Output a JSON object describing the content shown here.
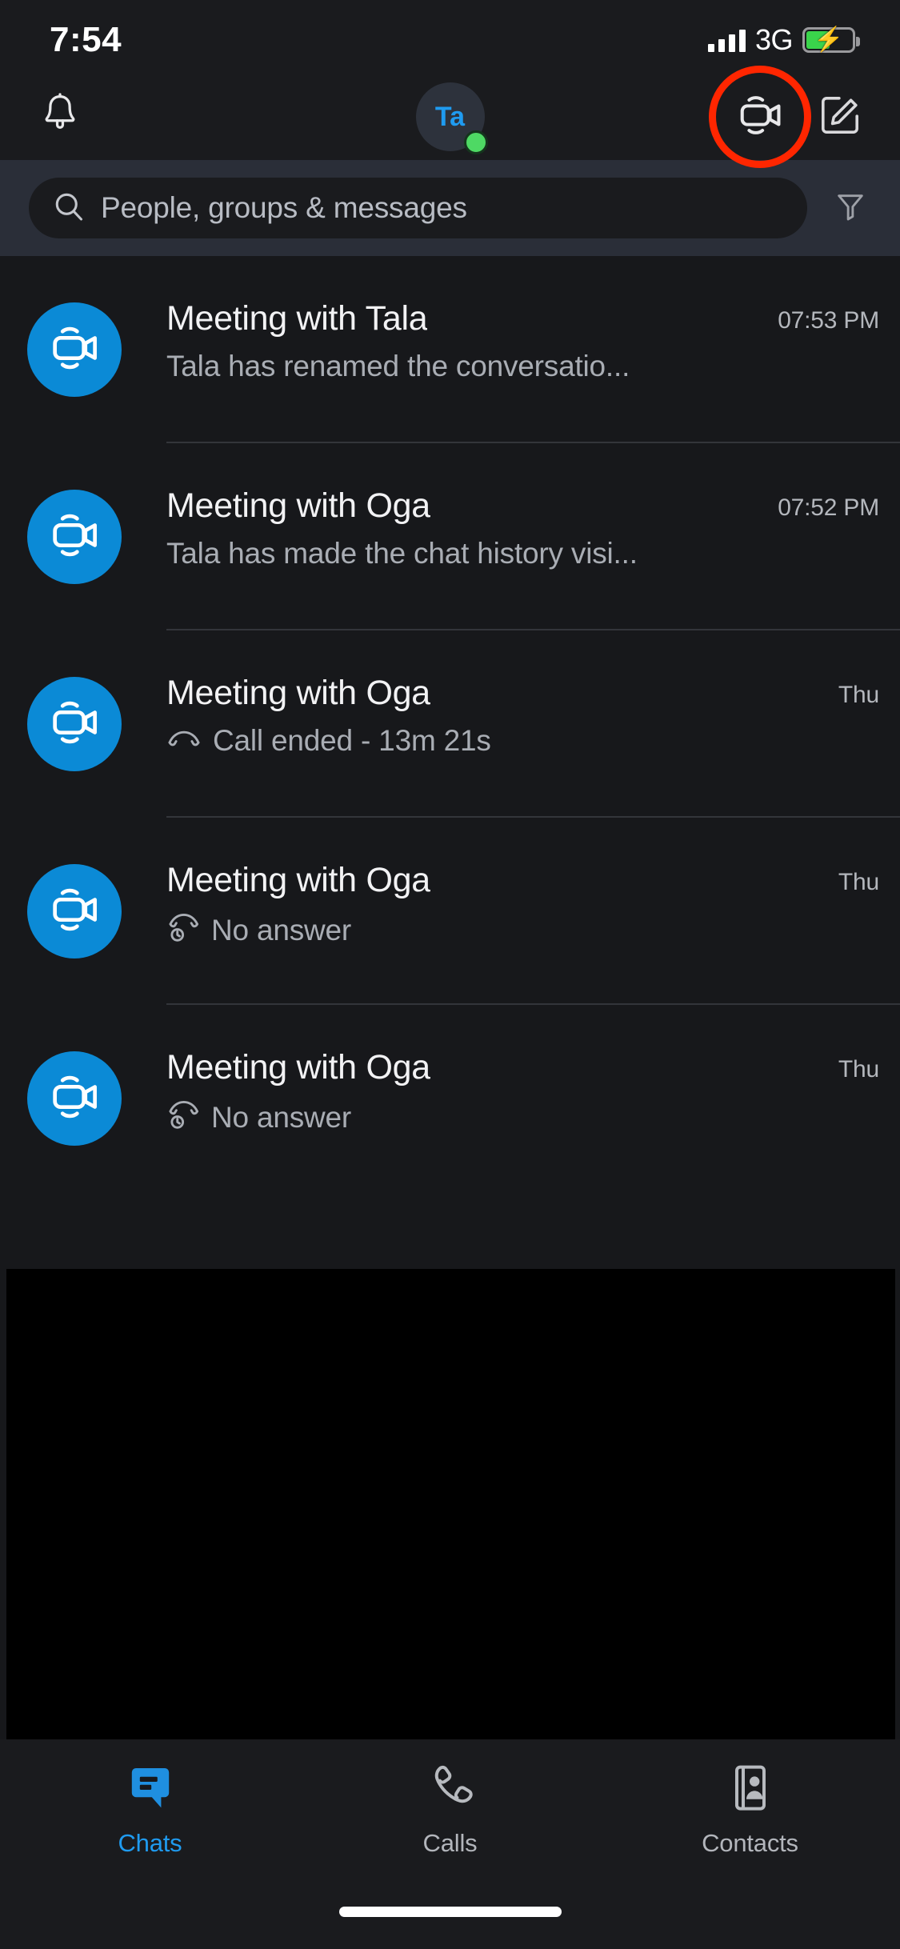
{
  "status_bar": {
    "time": "7:54",
    "carrier": "3G",
    "signal_icon": "signal-bars-icon",
    "battery_icon": "battery-charging-icon",
    "battery_level_percent": 52
  },
  "nav_bar": {
    "notifications_icon": "bell-icon",
    "avatar": {
      "initials": "Ta",
      "presence": "available",
      "presence_color": "#4ed964",
      "text_color": "#1f9bf0"
    },
    "video_call_icon": "video-camera-icon",
    "video_call_highlighted": true,
    "highlight_color": "#ff2600",
    "compose_icon": "compose-pencil-icon"
  },
  "search": {
    "placeholder": "People, groups & messages",
    "value": "",
    "search_icon": "search-icon",
    "filter_icon": "filter-funnel-icon"
  },
  "chat_list": {
    "avatar_color": "#0b8ad6",
    "items": [
      {
        "avatar_icon": "video-camera-icon",
        "title": "Meeting with Tala",
        "subtitle": "Tala has renamed the conversatio...",
        "status_icon": "none",
        "time": "07:53 PM"
      },
      {
        "avatar_icon": "video-camera-icon",
        "title": "Meeting with Oga",
        "subtitle": "Tala has made the chat history visi...",
        "status_icon": "none",
        "time": "07:52 PM"
      },
      {
        "avatar_icon": "video-camera-icon",
        "title": "Meeting with Oga",
        "subtitle": "Call ended - 13m 21s",
        "status_icon": "call-ended-icon",
        "time": "Thu"
      },
      {
        "avatar_icon": "video-camera-icon",
        "title": "Meeting with Oga",
        "subtitle": "No answer",
        "status_icon": "call-no-answer-icon",
        "time": "Thu"
      },
      {
        "avatar_icon": "video-camera-icon",
        "title": "Meeting with Oga",
        "subtitle": "No answer",
        "status_icon": "call-no-answer-icon",
        "time": "Thu"
      }
    ]
  },
  "tab_bar": {
    "active_color": "#1f9bf0",
    "inactive_color": "#b3b6bc",
    "tabs": [
      {
        "label": "Chats",
        "icon": "chat-bubble-icon",
        "active": true
      },
      {
        "label": "Calls",
        "icon": "phone-handset-icon",
        "active": false
      },
      {
        "label": "Contacts",
        "icon": "contact-card-icon",
        "active": false
      }
    ]
  }
}
